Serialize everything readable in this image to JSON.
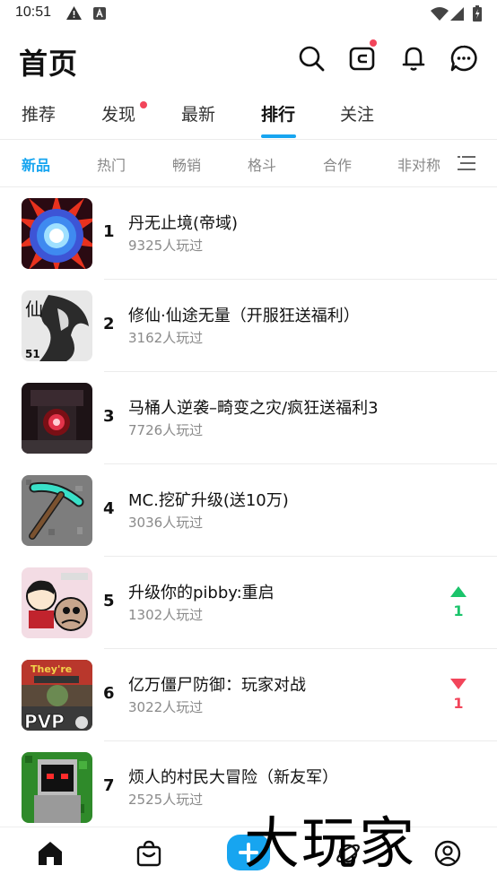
{
  "status_bar": {
    "time": "10:51"
  },
  "header": {
    "title": "首页"
  },
  "tabs": [
    {
      "label": "推荐"
    },
    {
      "label": "发现"
    },
    {
      "label": "最新"
    },
    {
      "label": "排行"
    },
    {
      "label": "关注"
    }
  ],
  "subtabs": [
    {
      "label": "新品"
    },
    {
      "label": "热门"
    },
    {
      "label": "畅销"
    },
    {
      "label": "格斗"
    },
    {
      "label": "合作"
    },
    {
      "label": "非对称"
    }
  ],
  "games": [
    {
      "rank": "1",
      "name": "丹无止境(帝域)",
      "plays": "9325人玩过"
    },
    {
      "rank": "2",
      "name": "修仙·仙途无量（开服狂送福利）",
      "plays": "3162人玩过"
    },
    {
      "rank": "3",
      "name": "马桶人逆袭–畸变之灾/疯狂送福利3",
      "plays": "7726人玩过"
    },
    {
      "rank": "4",
      "name": "MC.挖矿升级(送10万)",
      "plays": "3036人玩过"
    },
    {
      "rank": "5",
      "name": "升级你的pibby:重启",
      "plays": "1302人玩过",
      "trend": "1"
    },
    {
      "rank": "6",
      "name": "亿万僵尸防御：玩家对战",
      "plays": "3022人玩过",
      "trend": "1"
    },
    {
      "rank": "7",
      "name": "烦人的村民大冒险（新友军）",
      "plays": "2525人玩过"
    }
  ],
  "watermark": "大玩家",
  "colors": {
    "accent": "#17a5f0",
    "up": "#1bc46b",
    "down": "#f2455a",
    "dot": "#f2455a"
  }
}
